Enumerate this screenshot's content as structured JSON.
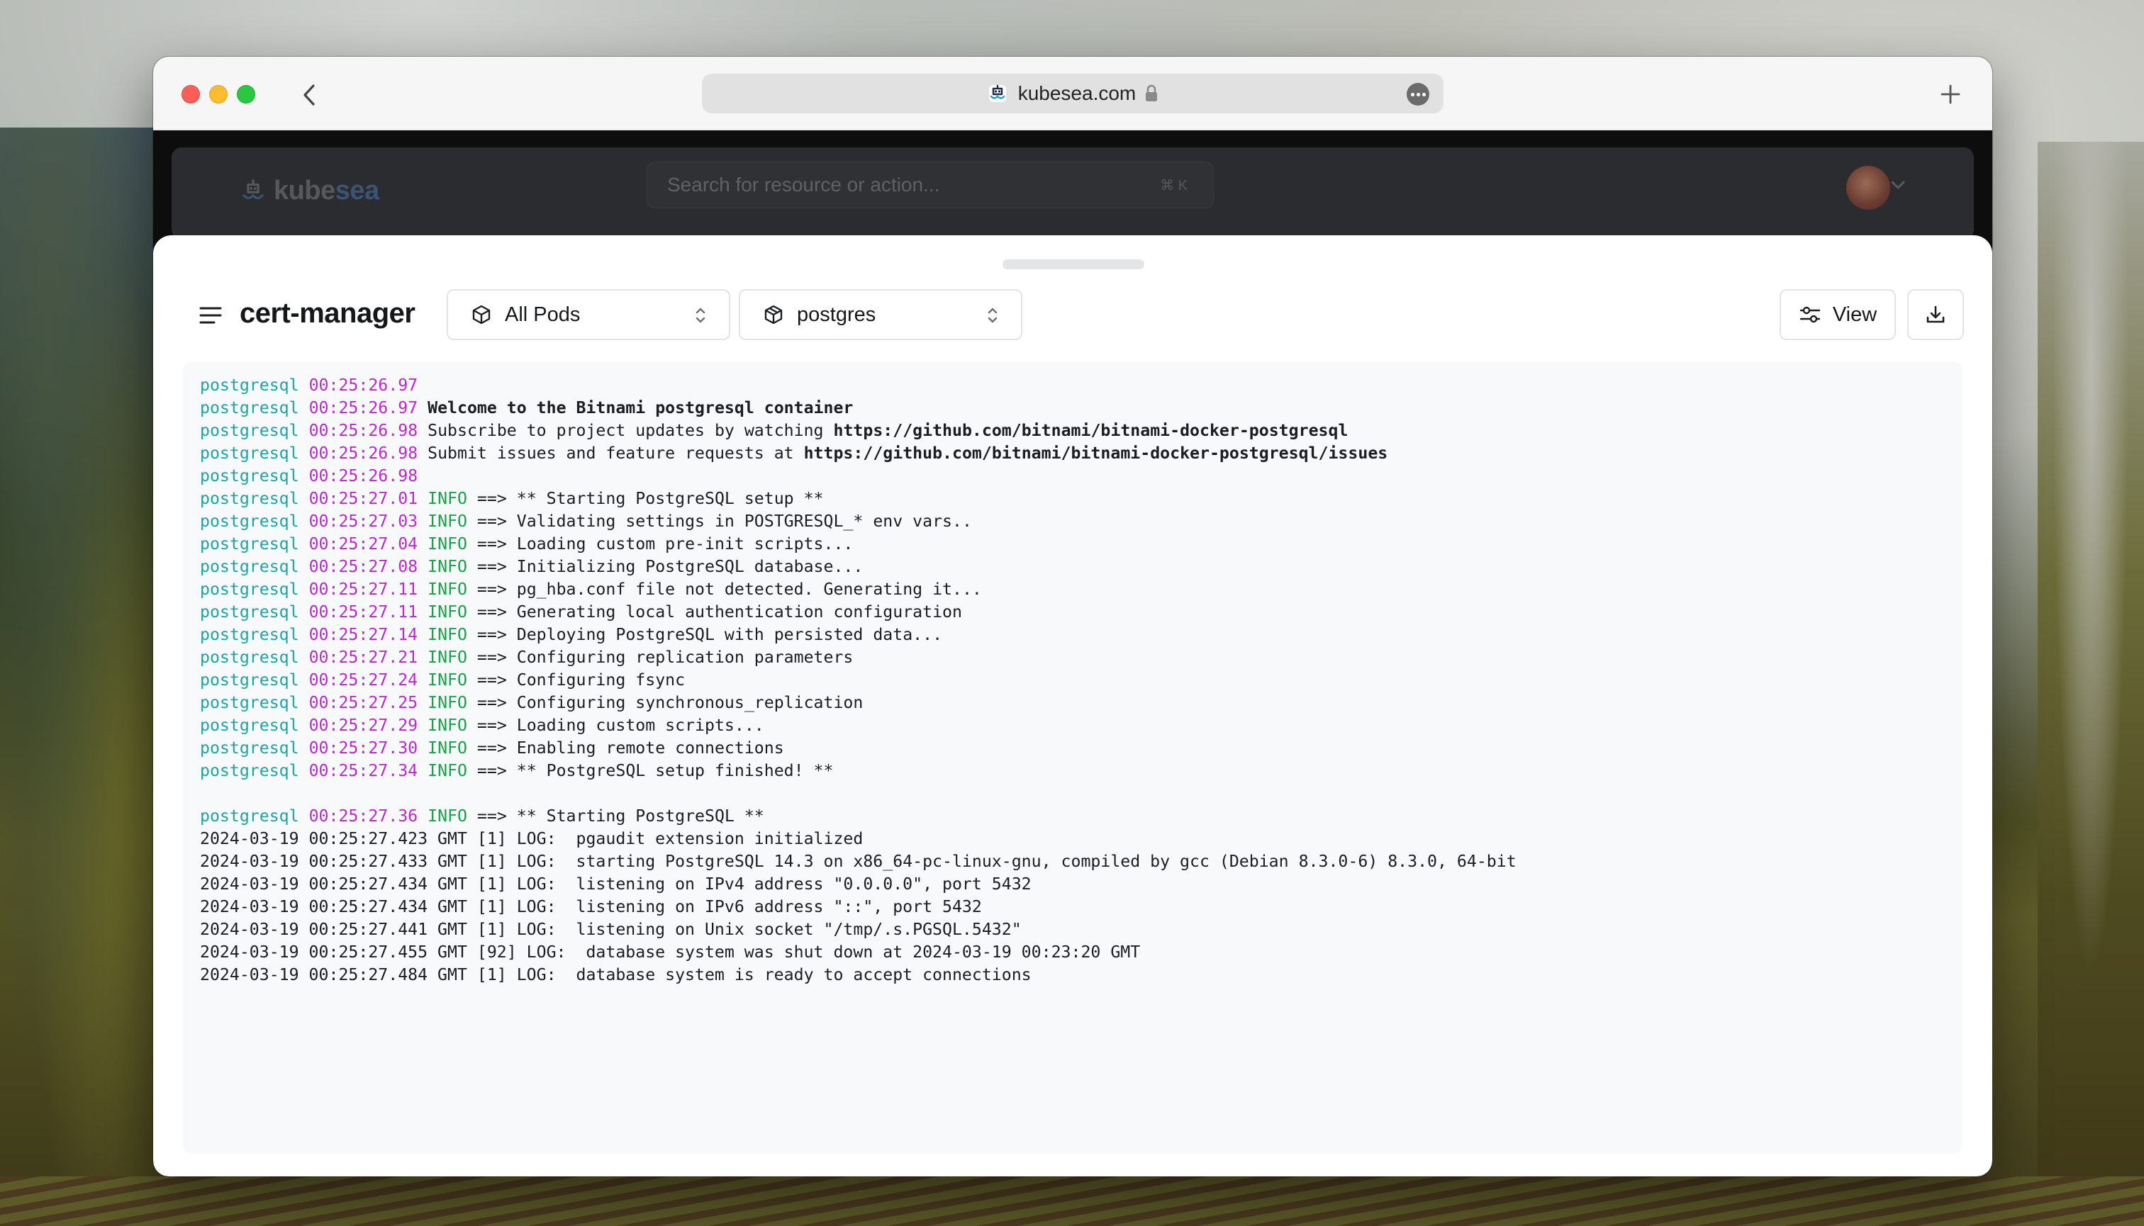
{
  "browser": {
    "url": "kubesea.com"
  },
  "app": {
    "brand_prefix": "kube",
    "brand_suffix": "sea",
    "search_placeholder": "Search for resource or action...",
    "search_shortcut": "⌘ K"
  },
  "toolbar": {
    "namespace": "cert-manager",
    "pods_select": "All Pods",
    "container_select": "postgres",
    "view_label": "View"
  },
  "logs": [
    {
      "pod": "postgresql",
      "ts": "00:25:26.97",
      "msg": ""
    },
    {
      "pod": "postgresql",
      "ts": "00:25:26.97",
      "msg": "Welcome to the Bitnami postgresql container",
      "bold": true
    },
    {
      "pod": "postgresql",
      "ts": "00:25:26.98",
      "msg": "Subscribe to project updates by watching ",
      "link": "https://github.com/bitnami/bitnami-docker-postgresql"
    },
    {
      "pod": "postgresql",
      "ts": "00:25:26.98",
      "msg": "Submit issues and feature requests at ",
      "link": "https://github.com/bitnami/bitnami-docker-postgresql/issues"
    },
    {
      "pod": "postgresql",
      "ts": "00:25:26.98",
      "msg": ""
    },
    {
      "pod": "postgresql",
      "ts": "00:25:27.01",
      "level": "INFO",
      "msg": " ==> ** Starting PostgreSQL setup **"
    },
    {
      "pod": "postgresql",
      "ts": "00:25:27.03",
      "level": "INFO",
      "msg": " ==> Validating settings in POSTGRESQL_* env vars.."
    },
    {
      "pod": "postgresql",
      "ts": "00:25:27.04",
      "level": "INFO",
      "msg": " ==> Loading custom pre-init scripts..."
    },
    {
      "pod": "postgresql",
      "ts": "00:25:27.08",
      "level": "INFO",
      "msg": " ==> Initializing PostgreSQL database..."
    },
    {
      "pod": "postgresql",
      "ts": "00:25:27.11",
      "level": "INFO",
      "msg": " ==> pg_hba.conf file not detected. Generating it..."
    },
    {
      "pod": "postgresql",
      "ts": "00:25:27.11",
      "level": "INFO",
      "msg": " ==> Generating local authentication configuration"
    },
    {
      "pod": "postgresql",
      "ts": "00:25:27.14",
      "level": "INFO",
      "msg": " ==> Deploying PostgreSQL with persisted data..."
    },
    {
      "pod": "postgresql",
      "ts": "00:25:27.21",
      "level": "INFO",
      "msg": " ==> Configuring replication parameters"
    },
    {
      "pod": "postgresql",
      "ts": "00:25:27.24",
      "level": "INFO",
      "msg": " ==> Configuring fsync"
    },
    {
      "pod": "postgresql",
      "ts": "00:25:27.25",
      "level": "INFO",
      "msg": " ==> Configuring synchronous_replication"
    },
    {
      "pod": "postgresql",
      "ts": "00:25:27.29",
      "level": "INFO",
      "msg": " ==> Loading custom scripts..."
    },
    {
      "pod": "postgresql",
      "ts": "00:25:27.30",
      "level": "INFO",
      "msg": " ==> Enabling remote connections"
    },
    {
      "pod": "postgresql",
      "ts": "00:25:27.34",
      "level": "INFO",
      "msg": " ==> ** PostgreSQL setup finished! **"
    },
    {
      "blank": true
    },
    {
      "pod": "postgresql",
      "ts": "00:25:27.36",
      "level": "INFO",
      "msg": " ==> ** Starting PostgreSQL **"
    },
    {
      "raw": "2024-03-19 00:25:27.423 GMT [1] LOG:  pgaudit extension initialized"
    },
    {
      "raw": "2024-03-19 00:25:27.433 GMT [1] LOG:  starting PostgreSQL 14.3 on x86_64-pc-linux-gnu, compiled by gcc (Debian 8.3.0-6) 8.3.0, 64-bit"
    },
    {
      "raw": "2024-03-19 00:25:27.434 GMT [1] LOG:  listening on IPv4 address \"0.0.0.0\", port 5432"
    },
    {
      "raw": "2024-03-19 00:25:27.434 GMT [1] LOG:  listening on IPv6 address \"::\", port 5432"
    },
    {
      "raw": "2024-03-19 00:25:27.441 GMT [1] LOG:  listening on Unix socket \"/tmp/.s.PGSQL.5432\""
    },
    {
      "raw": "2024-03-19 00:25:27.455 GMT [92] LOG:  database system was shut down at 2024-03-19 00:23:20 GMT"
    },
    {
      "raw": "2024-03-19 00:25:27.484 GMT [1] LOG:  database system is ready to accept connections"
    }
  ],
  "colors": {
    "pod": "#1aa6a6",
    "timestamp": "#c026d3",
    "info": "#16a34a"
  }
}
